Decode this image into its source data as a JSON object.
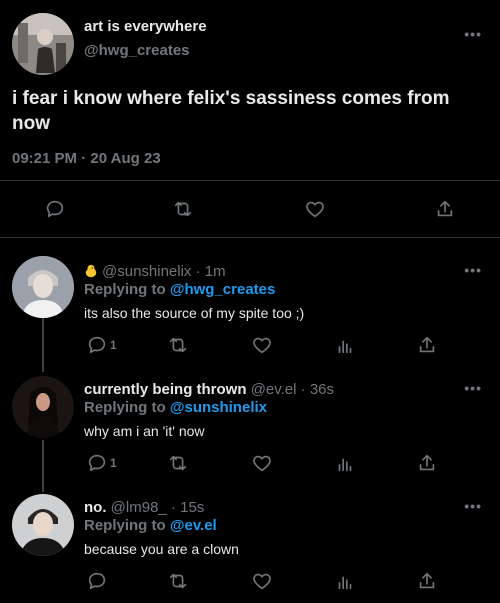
{
  "main_tweet": {
    "display_name": "art is everywhere",
    "handle": "@hwg_creates",
    "text": "i fear i know where felix's sassiness comes from now",
    "timestamp": "09:21 PM · 20 Aug 23",
    "more_label": "•••"
  },
  "replies": [
    {
      "display_name": "",
      "emoji": "chick-icon",
      "handle": "@sunshinelix",
      "time": "· 1m",
      "replying_prefix": "Replying to ",
      "replying_to": "@hwg_creates",
      "text": "its also the source of my spite too ;)",
      "reply_count": "1",
      "more_label": "•••"
    },
    {
      "display_name": "currently being thrown",
      "handle": "@ev.el",
      "time": "· 36s",
      "replying_prefix": "Replying to ",
      "replying_to": "@sunshinelix",
      "text": "why am i an 'it' now",
      "reply_count": "1",
      "more_label": "•••"
    },
    {
      "display_name": "no.",
      "handle": "@lm98_",
      "time": "· 15s",
      "replying_prefix": "Replying to ",
      "replying_to": "@ev.el",
      "text": "because you are a clown",
      "reply_count": "",
      "more_label": "•••"
    }
  ],
  "colors": {
    "background": "#000000",
    "text": "#e7e9ea",
    "muted": "#71767b",
    "link": "#1d9bf0",
    "divider": "#2f3336"
  }
}
